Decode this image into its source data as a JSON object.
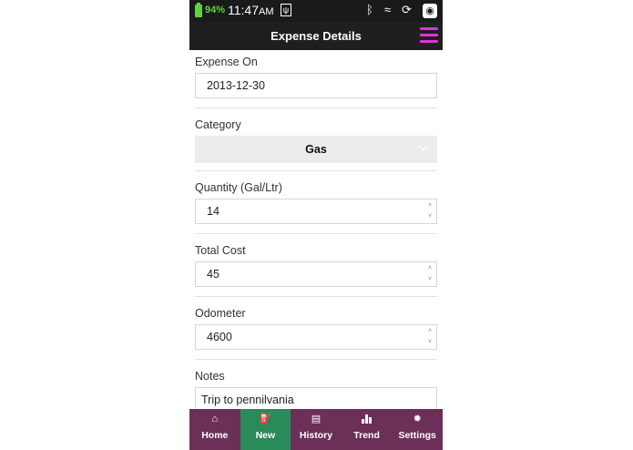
{
  "status_bar": {
    "battery_percent": "94%",
    "time": "11:47",
    "time_suffix": "AM",
    "icons": [
      "battery-icon",
      "usb-icon",
      "bluetooth-icon",
      "wifi-icon",
      "sync-icon",
      "app-icon"
    ]
  },
  "header": {
    "title": "Expense Details",
    "menu_icon": "hamburger-menu-icon"
  },
  "form": {
    "expense_on": {
      "label": "Expense On",
      "value": "2013-12-30"
    },
    "category": {
      "label": "Category",
      "value": "Gas"
    },
    "quantity": {
      "label": "Quantity (Gal/Ltr)",
      "value": "14"
    },
    "total_cost": {
      "label": "Total Cost",
      "value": "45"
    },
    "odometer": {
      "label": "Odometer",
      "value": "4600"
    },
    "notes": {
      "label": "Notes",
      "value": "Trip to pennilvania"
    }
  },
  "bottom_nav": {
    "items": [
      {
        "label": "Home",
        "icon": "home-icon"
      },
      {
        "label": "New",
        "icon": "gas-pump-icon"
      },
      {
        "label": "History",
        "icon": "history-icon"
      },
      {
        "label": "Trend",
        "icon": "bar-chart-icon"
      },
      {
        "label": "Settings",
        "icon": "gear-icon"
      }
    ],
    "active": "New"
  },
  "colors": {
    "menu_accent": "#e133d3",
    "nav_background": "#6b2f58",
    "nav_active": "#2a8a5a",
    "battery": "#5fd33a"
  }
}
